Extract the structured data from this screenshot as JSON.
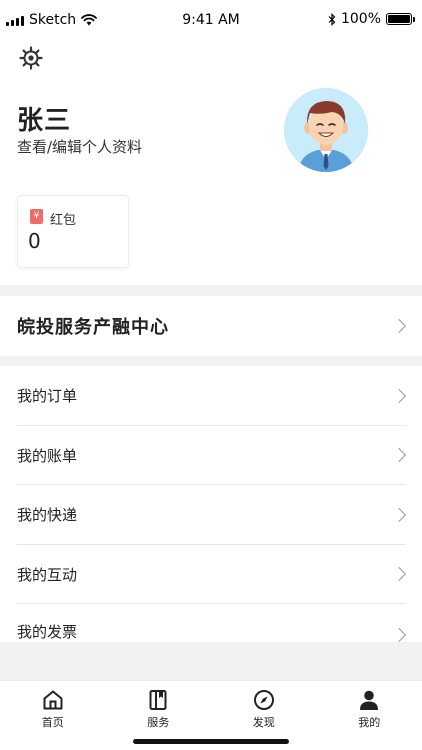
{
  "status_bar": {
    "carrier": "Sketch",
    "time": "9:41 AM",
    "battery": "100%"
  },
  "profile": {
    "name": "张三",
    "edit_link": "查看/编辑个人资料"
  },
  "red_packet": {
    "icon_glyph": "¥",
    "label": "红包",
    "value": "0"
  },
  "service_center": {
    "label": "皖投服务产融中心"
  },
  "menu": [
    {
      "label": "我的订单"
    },
    {
      "label": "我的账单"
    },
    {
      "label": "我的快递"
    },
    {
      "label": "我的互动"
    },
    {
      "label": "我的发票"
    }
  ],
  "tabs": [
    {
      "label": "首页",
      "icon": "home-icon"
    },
    {
      "label": "服务",
      "icon": "book-icon"
    },
    {
      "label": "发现",
      "icon": "compass-icon"
    },
    {
      "label": "我的",
      "icon": "person-icon",
      "active": true
    }
  ],
  "colors": {
    "red_packet_accent": "#f26a6a",
    "avatar_bg": "#c9ecfb",
    "section_gap": "#f2f2f2"
  }
}
